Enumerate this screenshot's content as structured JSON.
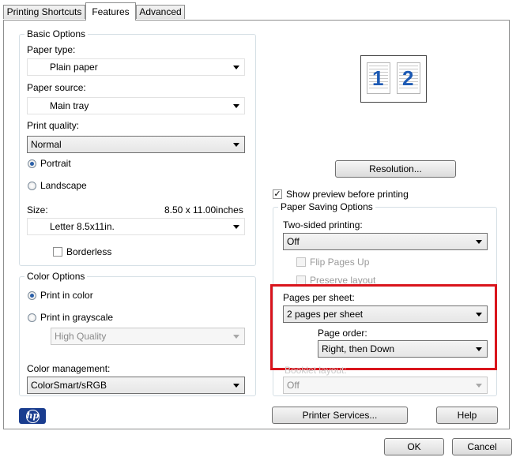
{
  "tabs": [
    {
      "label": "Printing Shortcuts",
      "active": false
    },
    {
      "label": "Features",
      "active": true
    },
    {
      "label": "Advanced",
      "active": false
    }
  ],
  "basic_options": {
    "legend": "Basic Options",
    "paper_type_label": "Paper type:",
    "paper_type_value": "Plain paper",
    "paper_source_label": "Paper source:",
    "paper_source_value": "Main tray",
    "print_quality_label": "Print quality:",
    "print_quality_value": "Normal",
    "portrait_label": "Portrait",
    "landscape_label": "Landscape",
    "orientation_selected": "Portrait",
    "size_label": "Size:",
    "size_dimensions": "8.50 x 11.00inches",
    "size_value": "Letter 8.5x11in.",
    "borderless_label": "Borderless",
    "borderless_checked": false
  },
  "color_options": {
    "legend": "Color Options",
    "print_in_color_label": "Print in color",
    "print_in_grayscale_label": "Print in grayscale",
    "selected": "Print in color",
    "grayscale_quality_value": "High Quality",
    "color_management_label": "Color management:",
    "color_management_value": "ColorSmart/sRGB"
  },
  "preview": {
    "page_numbers": [
      "1",
      "2"
    ]
  },
  "resolution_button": "Resolution...",
  "show_preview_label": "Show preview before printing",
  "show_preview_checked": true,
  "paper_saving": {
    "legend": "Paper Saving Options",
    "two_sided_label": "Two-sided printing:",
    "two_sided_value": "Off",
    "flip_pages_up_label": "Flip Pages Up",
    "preserve_layout_label": "Preserve layout",
    "pages_per_sheet_label": "Pages per sheet:",
    "pages_per_sheet_value": "2 pages per sheet",
    "page_order_label": "Page order:",
    "page_order_value": "Right, then Down",
    "booklet_layout_label": "Booklet layout:",
    "booklet_layout_value": "Off"
  },
  "logo_text": "hp",
  "printer_services_button": "Printer Services...",
  "help_button": "Help",
  "ok_button": "OK",
  "cancel_button": "Cancel",
  "highlight_color": "#d9141c"
}
